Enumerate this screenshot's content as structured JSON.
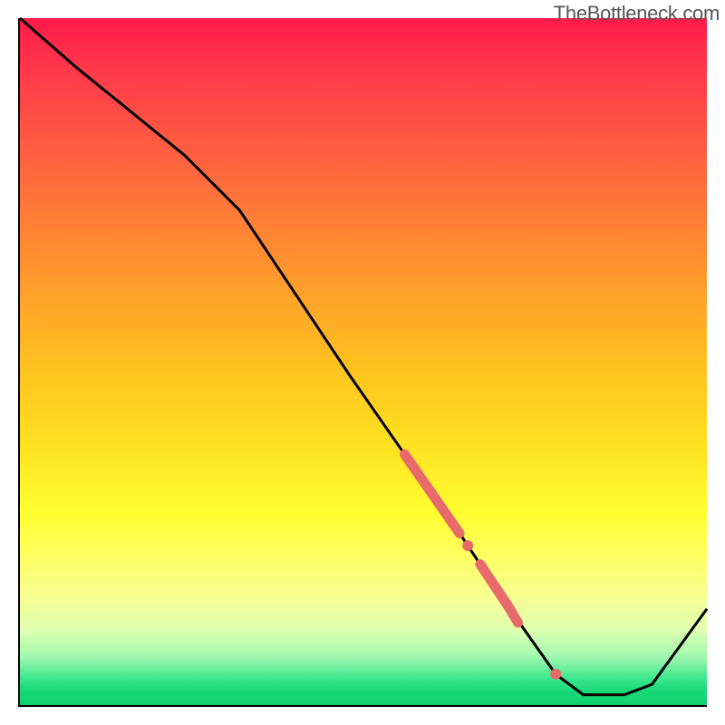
{
  "watermark": "TheBottleneck.com",
  "chart_data": {
    "type": "line",
    "title": "",
    "xlabel": "",
    "ylabel": "",
    "xlim": [
      0,
      100
    ],
    "ylim": [
      0,
      100
    ],
    "grid": false,
    "series": [
      {
        "name": "main-curve",
        "color": "#000000",
        "x": [
          0,
          8,
          16,
          24,
          32,
          40,
          48,
          56,
          64,
          72,
          78,
          82,
          88,
          92,
          100
        ],
        "values": [
          100,
          93,
          86.5,
          80,
          72,
          60,
          48,
          36.5,
          25,
          13,
          4.5,
          1.5,
          1.5,
          3,
          14
        ]
      },
      {
        "name": "highlight-segment",
        "color": "#e86a6a",
        "thick": true,
        "x": [
          56,
          64
        ],
        "values": [
          36.5,
          25
        ]
      },
      {
        "name": "highlight-dash-1",
        "color": "#e86a6a",
        "thick": true,
        "x": [
          67,
          71
        ],
        "values": [
          20.5,
          14.5
        ]
      },
      {
        "name": "highlight-dash-2",
        "color": "#e86a6a",
        "thick": true,
        "x": [
          71,
          72.5
        ],
        "values": [
          14.5,
          12
        ]
      }
    ],
    "points": [
      {
        "name": "dot-1",
        "color": "#e86a6a",
        "x": 65.2,
        "y": 23.2
      },
      {
        "name": "dot-2",
        "color": "#e86a6a",
        "x": 78,
        "y": 4.5
      }
    ]
  }
}
